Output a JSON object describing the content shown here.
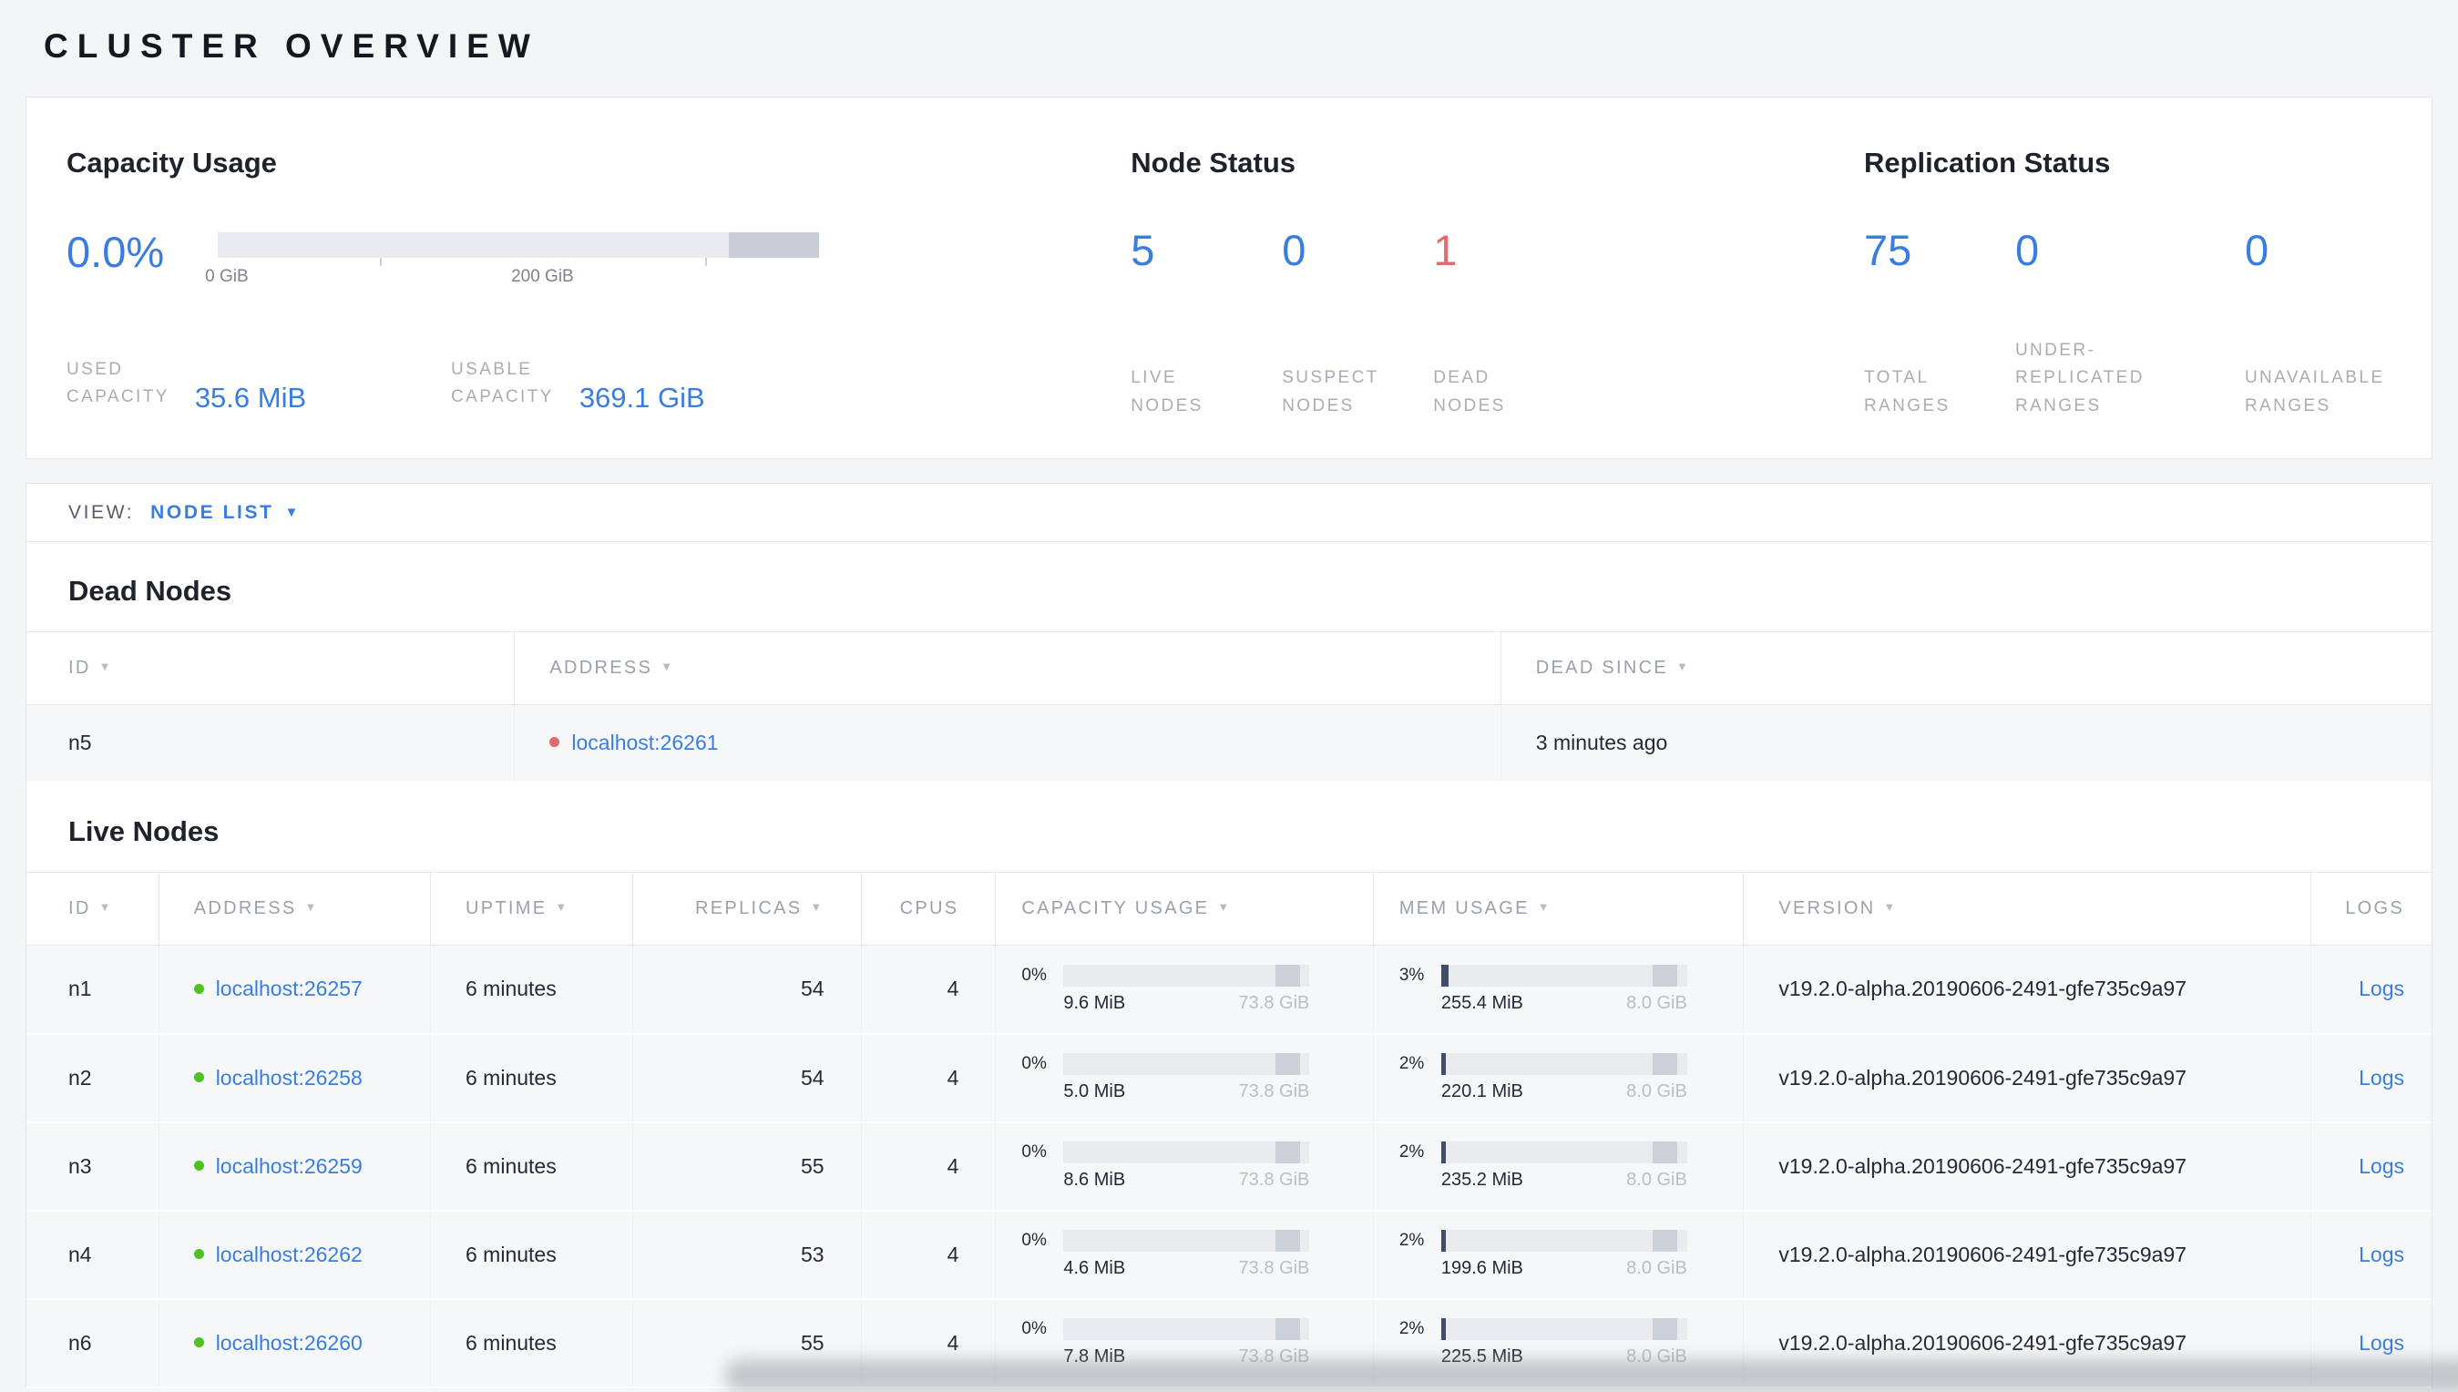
{
  "colors": {
    "accent_blue": "#3a7de1",
    "danger_red": "#e06c6f",
    "live_green": "#4fc122"
  },
  "icons": {
    "sort_desc": "▼",
    "dropdown_caret": "▼"
  },
  "page": {
    "title": "CLUSTER OVERVIEW"
  },
  "summary": {
    "capacity_usage": {
      "title": "Capacity Usage",
      "percent": "0.0%",
      "axis_labels": [
        "0 GiB",
        "200 GiB"
      ],
      "stats": [
        {
          "label_lines": [
            "USED",
            "CAPACITY"
          ],
          "value": "35.6 MiB"
        },
        {
          "label_lines": [
            "USABLE",
            "CAPACITY"
          ],
          "value": "369.1 GiB"
        }
      ]
    },
    "node_status": {
      "title": "Node Status",
      "stats": [
        {
          "value": "5",
          "label_lines": [
            "LIVE",
            "NODES"
          ]
        },
        {
          "value": "0",
          "label_lines": [
            "SUSPECT",
            "NODES"
          ]
        },
        {
          "value": "1",
          "label_lines": [
            "DEAD",
            "NODES"
          ]
        }
      ]
    },
    "replication_status": {
      "title": "Replication Status",
      "stats": [
        {
          "value": "75",
          "label_lines": [
            "TOTAL",
            "RANGES"
          ]
        },
        {
          "value": "0",
          "label_lines": [
            "UNDER-",
            "REPLICATED",
            "RANGES"
          ]
        },
        {
          "value": "0",
          "label_lines": [
            "UNAVAILABLE",
            "RANGES"
          ]
        }
      ]
    }
  },
  "view_bar": {
    "label": "VIEW:",
    "selected": "NODE LIST"
  },
  "dead_nodes": {
    "title": "Dead Nodes",
    "columns": [
      "ID",
      "ADDRESS",
      "DEAD SINCE"
    ],
    "rows": [
      {
        "id": "n5",
        "address": "localhost:26261",
        "dead_since": "3 minutes ago"
      }
    ]
  },
  "live_nodes": {
    "title": "Live Nodes",
    "columns": [
      "ID",
      "ADDRESS",
      "UPTIME",
      "REPLICAS",
      "CPUS",
      "CAPACITY USAGE",
      "MEM USAGE",
      "VERSION",
      "LOGS"
    ],
    "rows": [
      {
        "id": "n1",
        "address": "localhost:26257",
        "uptime": "6 minutes",
        "replicas": "54",
        "cpus": "4",
        "capacity_percent": "0%",
        "capacity_pct": 0,
        "capacity_used": "9.6 MiB",
        "capacity_total": "73.8 GiB",
        "mem_percent": "3%",
        "mem_pct": 3,
        "mem_used": "255.4 MiB",
        "mem_total": "8.0 GiB",
        "version": "v19.2.0-alpha.20190606-2491-gfe735c9a97",
        "logs": "Logs"
      },
      {
        "id": "n2",
        "address": "localhost:26258",
        "uptime": "6 minutes",
        "replicas": "54",
        "cpus": "4",
        "capacity_percent": "0%",
        "capacity_pct": 0,
        "capacity_used": "5.0 MiB",
        "capacity_total": "73.8 GiB",
        "mem_percent": "2%",
        "mem_pct": 2,
        "mem_used": "220.1 MiB",
        "mem_total": "8.0 GiB",
        "version": "v19.2.0-alpha.20190606-2491-gfe735c9a97",
        "logs": "Logs"
      },
      {
        "id": "n3",
        "address": "localhost:26259",
        "uptime": "6 minutes",
        "replicas": "55",
        "cpus": "4",
        "capacity_percent": "0%",
        "capacity_pct": 0,
        "capacity_used": "8.6 MiB",
        "capacity_total": "73.8 GiB",
        "mem_percent": "2%",
        "mem_pct": 2,
        "mem_used": "235.2 MiB",
        "mem_total": "8.0 GiB",
        "version": "v19.2.0-alpha.20190606-2491-gfe735c9a97",
        "logs": "Logs"
      },
      {
        "id": "n4",
        "address": "localhost:26262",
        "uptime": "6 minutes",
        "replicas": "53",
        "cpus": "4",
        "capacity_percent": "0%",
        "capacity_pct": 0,
        "capacity_used": "4.6 MiB",
        "capacity_total": "73.8 GiB",
        "mem_percent": "2%",
        "mem_pct": 2,
        "mem_used": "199.6 MiB",
        "mem_total": "8.0 GiB",
        "version": "v19.2.0-alpha.20190606-2491-gfe735c9a97",
        "logs": "Logs"
      },
      {
        "id": "n6",
        "address": "localhost:26260",
        "uptime": "6 minutes",
        "replicas": "55",
        "cpus": "4",
        "capacity_percent": "0%",
        "capacity_pct": 0,
        "capacity_used": "7.8 MiB",
        "capacity_total": "73.8 GiB",
        "mem_percent": "2%",
        "mem_pct": 2,
        "mem_used": "225.5 MiB",
        "mem_total": "8.0 GiB",
        "version": "v19.2.0-alpha.20190606-2491-gfe735c9a97",
        "logs": "Logs"
      }
    ]
  }
}
